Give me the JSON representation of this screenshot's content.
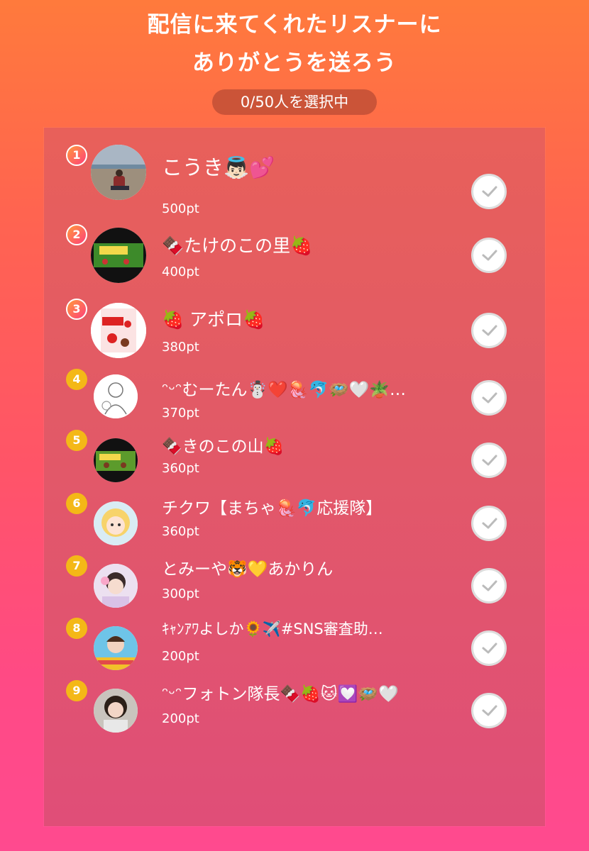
{
  "header": {
    "title_line1": "配信に来てくれたリスナーに",
    "title_line2": "ありがとうを送ろう",
    "selection_count": "0/50人を選択中"
  },
  "listeners": [
    {
      "rank": "1",
      "name": "こうき👼🏻💕",
      "points": "500pt",
      "avatar": "beach-photo"
    },
    {
      "rank": "2",
      "name": "🍫たけのこの里🍓",
      "points": "400pt",
      "avatar": "snack-box-green"
    },
    {
      "rank": "3",
      "name": "🍓 アポロ🍓",
      "points": "380pt",
      "avatar": "strawberry-candy-box"
    },
    {
      "rank": "4",
      "name": "ᵔᵕᵔむーたん☃️❤️🪼🐬🪺🤍🪴…",
      "points": "370pt",
      "avatar": "line-drawing"
    },
    {
      "rank": "5",
      "name": "🍫きのこの山🍓",
      "points": "360pt",
      "avatar": "snack-box-green"
    },
    {
      "rank": "6",
      "name": "チクワ【まちゃ🪼🐬応援隊】",
      "points": "360pt",
      "avatar": "doll-photo"
    },
    {
      "rank": "7",
      "name": "とみーや🐯💛あかりん",
      "points": "300pt",
      "avatar": "person-photo"
    },
    {
      "rank": "8",
      "name": "ｷｬﾝｱﾜよしか🌻✈️#SNS審査助…",
      "points": "200pt",
      "avatar": "banner-photo"
    },
    {
      "rank": "9",
      "name": "ᵔᵕᵔフォトン隊長🍫🍓🐱💟🪺🤍",
      "points": "200pt",
      "avatar": "person-photo"
    }
  ],
  "colors": {
    "rank_top": "#ff5a5a",
    "rank_gold": "#f4b817",
    "check_mark": "#bbbbbb"
  }
}
